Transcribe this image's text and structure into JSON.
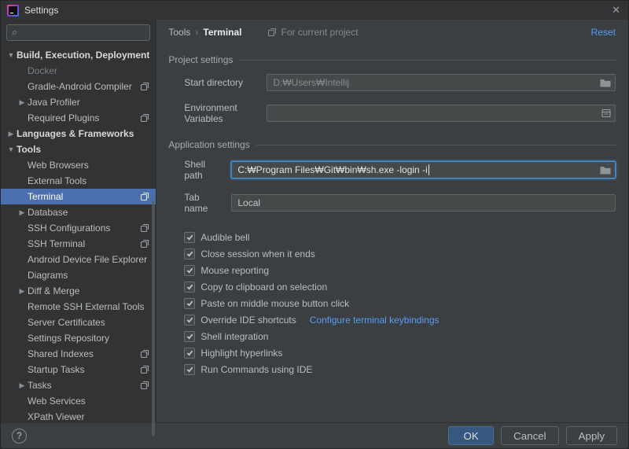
{
  "window": {
    "title": "Settings"
  },
  "icons": {
    "close": "✕",
    "search": "⌕",
    "chevron_down": "▼",
    "chevron_right": "▶",
    "help": "?"
  },
  "colors": {
    "selection": "#4b6eaf",
    "link": "#589df6",
    "ok_button": "#365880",
    "focus_border": "#4a88c7"
  },
  "sidebar": {
    "search": {
      "value": ""
    },
    "items": [
      {
        "label": "Build, Execution, Deployment",
        "level": 0,
        "arrow": "down",
        "bold": true
      },
      {
        "label": "Docker",
        "level": 1,
        "dim": true
      },
      {
        "label": "Gradle-Android Compiler",
        "level": 1,
        "icon": true
      },
      {
        "label": "Java Profiler",
        "level": 1,
        "arrow": "right"
      },
      {
        "label": "Required Plugins",
        "level": 1,
        "icon": true
      },
      {
        "label": "Languages & Frameworks",
        "level": 0,
        "arrow": "right",
        "bold": true
      },
      {
        "label": "Tools",
        "level": 0,
        "arrow": "down",
        "bold": true
      },
      {
        "label": "Web Browsers",
        "level": 1
      },
      {
        "label": "External Tools",
        "level": 1
      },
      {
        "label": "Terminal",
        "level": 1,
        "selected": true,
        "icon": true
      },
      {
        "label": "Database",
        "level": 1,
        "arrow": "right"
      },
      {
        "label": "SSH Configurations",
        "level": 1,
        "icon": true
      },
      {
        "label": "SSH Terminal",
        "level": 1,
        "icon": true
      },
      {
        "label": "Android Device File Explorer",
        "level": 1
      },
      {
        "label": "Diagrams",
        "level": 1
      },
      {
        "label": "Diff & Merge",
        "level": 1,
        "arrow": "right"
      },
      {
        "label": "Remote SSH External Tools",
        "level": 1
      },
      {
        "label": "Server Certificates",
        "level": 1
      },
      {
        "label": "Settings Repository",
        "level": 1
      },
      {
        "label": "Shared Indexes",
        "level": 1,
        "icon": true
      },
      {
        "label": "Startup Tasks",
        "level": 1,
        "icon": true
      },
      {
        "label": "Tasks",
        "level": 1,
        "arrow": "right",
        "icon": true
      },
      {
        "label": "Web Services",
        "level": 1
      },
      {
        "label": "XPath Viewer",
        "level": 1
      }
    ]
  },
  "breadcrumb": {
    "parent": "Tools",
    "separator": "›",
    "current": "Terminal",
    "scope": "For current project",
    "reset": "Reset"
  },
  "sections": {
    "project": {
      "title": "Project settings",
      "start_directory": {
        "label": "Start directory",
        "value": "D:₩Users₩Intellij"
      },
      "env_vars": {
        "label": "Environment Variables",
        "value": ""
      }
    },
    "application": {
      "title": "Application settings",
      "shell_path": {
        "label": "Shell path",
        "value": "C:₩Program Files₩Git₩bin₩sh.exe -login -i"
      },
      "tab_name": {
        "label": "Tab name",
        "value": "Local"
      },
      "checkboxes": [
        {
          "label": "Audible bell",
          "checked": true
        },
        {
          "label": "Close session when it ends",
          "checked": true
        },
        {
          "label": "Mouse reporting",
          "checked": true
        },
        {
          "label": "Copy to clipboard on selection",
          "checked": true
        },
        {
          "label": "Paste on middle mouse button click",
          "checked": true
        },
        {
          "label": "Override IDE shortcuts",
          "checked": true,
          "link": "Configure terminal keybindings"
        },
        {
          "label": "Shell integration",
          "checked": true
        },
        {
          "label": "Highlight hyperlinks",
          "checked": true
        },
        {
          "label": "Run Commands using IDE",
          "checked": true
        }
      ]
    }
  },
  "footer": {
    "ok": "OK",
    "cancel": "Cancel",
    "apply": "Apply"
  }
}
